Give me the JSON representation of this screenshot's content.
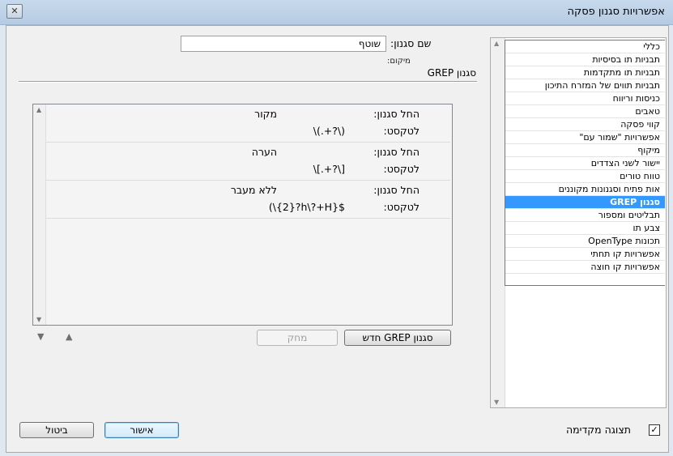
{
  "window": {
    "title": "אפשרויות סגנון פסקה",
    "close_glyph": "✕"
  },
  "categories": {
    "items": [
      {
        "label": "כללי",
        "selected": false
      },
      {
        "label": "תבניות תו בסיסיות",
        "selected": false
      },
      {
        "label": "תבניות תו מתקדמות",
        "selected": false
      },
      {
        "label": "תבניות תווים של המזרח התיכון",
        "selected": false
      },
      {
        "label": "כניסות וריווח",
        "selected": false
      },
      {
        "label": "טאבים",
        "selected": false
      },
      {
        "label": "קווי פסקה",
        "selected": false
      },
      {
        "label": "אפשרויות \"שמור עם\"",
        "selected": false
      },
      {
        "label": "מיקוף",
        "selected": false
      },
      {
        "label": "יישור לשני הצדדים",
        "selected": false
      },
      {
        "label": "טווח טורים",
        "selected": false
      },
      {
        "label": "אות פתיח וסגנונות מקוננים",
        "selected": false
      },
      {
        "label": "סגנון GREP",
        "selected": true
      },
      {
        "label": "תבליטים ומספור",
        "selected": false
      },
      {
        "label": "צבע תו",
        "selected": false
      },
      {
        "label": "תכונות OpenType",
        "selected": false
      },
      {
        "label": "אפשרויות קו תחתי",
        "selected": false
      },
      {
        "label": "אפשרויות קו חוצה",
        "selected": false
      }
    ]
  },
  "form": {
    "style_name_label": "שם סגנון:",
    "style_name_value": "שוטף",
    "location_label": "מיקום:",
    "section_title": "סגנון GREP"
  },
  "grep_rules": [
    {
      "apply_label": "החל סגנון:",
      "style": "מקור",
      "text_label": "לטקסט:",
      "expression": "\\(.+?\\)"
    },
    {
      "apply_label": "החל סגנון:",
      "style": "הערה",
      "text_label": "לטקסט:",
      "expression": "\\[.+?\\]"
    },
    {
      "apply_label": "החל סגנון:",
      "style": "ללא מעבר",
      "text_label": "לטקסט:",
      "expression": "(\\{2}?h\\?+H}$"
    }
  ],
  "buttons": {
    "new_grep": "סגנון GREP חדש",
    "delete": "מחק",
    "ok": "אישור",
    "cancel": "ביטול",
    "move_down": "▼",
    "move_up": "▲"
  },
  "preview": {
    "label": "תצוגה מקדימה",
    "checked": true,
    "check_glyph": "✓"
  },
  "scroll": {
    "up": "▲",
    "down": "▼"
  }
}
